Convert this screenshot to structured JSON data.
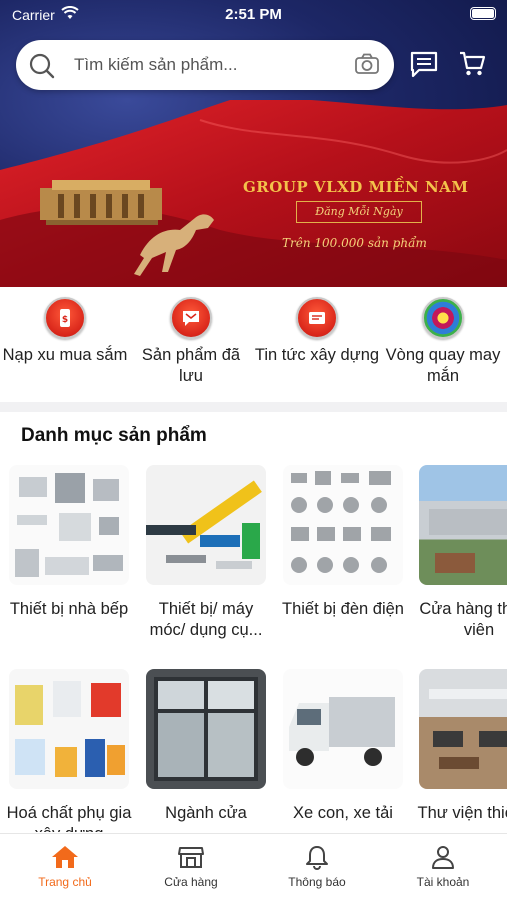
{
  "status_bar": {
    "carrier": "Carrier",
    "time": "2:51 PM"
  },
  "search": {
    "placeholder": "Tìm kiếm sản phẩm..."
  },
  "banner": {
    "title": "GROUP VLXD MIỀN NAM",
    "tagline": "Đăng Mỗi Ngày",
    "subtitle": "Trên 100.000 sản phẩm"
  },
  "quick_actions": [
    {
      "label": "Nạp xu mua sắm",
      "icon": "wallet-icon"
    },
    {
      "label": "Sản phẩm đã lưu",
      "icon": "saved-message-icon"
    },
    {
      "label": "Tin tức xây dựng",
      "icon": "news-icon"
    },
    {
      "label": "Vòng quay may mắn",
      "icon": "lucky-wheel-icon"
    }
  ],
  "categories": {
    "title": "Danh mục sản phẩm",
    "items": [
      {
        "label": "Thiết bị nhà bếp"
      },
      {
        "label": "Thiết bị/ máy móc/ dụng cụ..."
      },
      {
        "label": "Thiết bị đèn điện"
      },
      {
        "label": "Cửa hàng thành viên"
      },
      {
        "label": "Hoá chất phụ gia xây dựng"
      },
      {
        "label": "Ngành cửa"
      },
      {
        "label": "Xe con, xe tải"
      },
      {
        "label": "Thư viện thiết kế"
      }
    ]
  },
  "tabs": [
    {
      "label": "Trang chủ",
      "icon": "home-icon",
      "active": true
    },
    {
      "label": "Cửa hàng",
      "icon": "store-icon",
      "active": false
    },
    {
      "label": "Thông báo",
      "icon": "bell-icon",
      "active": false
    },
    {
      "label": "Tài khoản",
      "icon": "user-icon",
      "active": false
    }
  ],
  "colors": {
    "accent": "#f26a1b",
    "banner_red": "#c8141c",
    "banner_gold": "#f3c24b"
  }
}
